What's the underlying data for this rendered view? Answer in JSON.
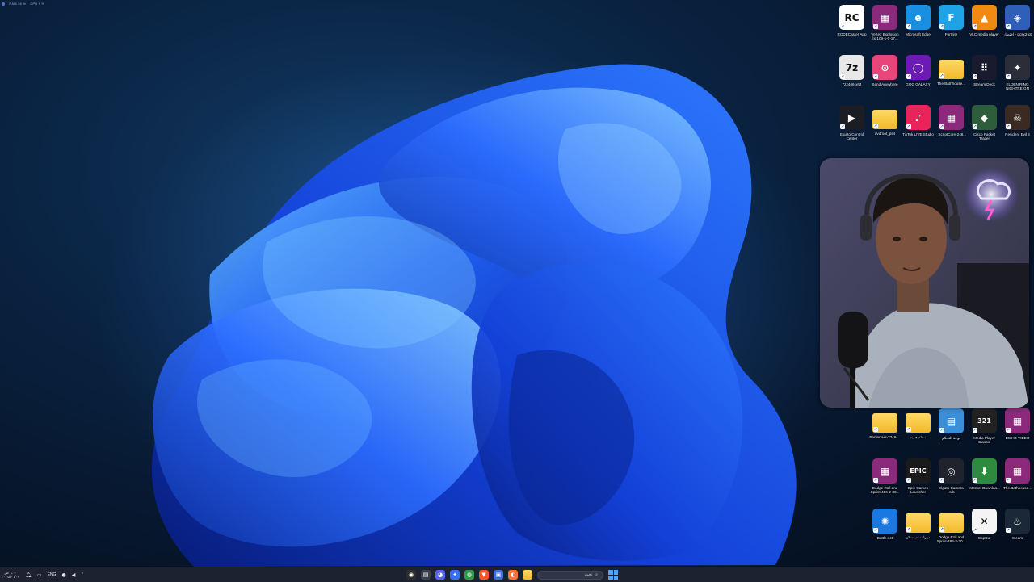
{
  "perf_overlay": [
    "RAM 28 %",
    "CPU 9 %"
  ],
  "desktop_icons": {
    "row1": [
      {
        "label": "RODECaster App",
        "icon": "rode-icon",
        "color": "#ffffff",
        "glyph": "RC"
      },
      {
        "label": "Vertex Explosion fix-109-1-0-17...",
        "icon": "winrar-icon",
        "color": "#8b2a7a",
        "glyph": "▦"
      },
      {
        "label": "Microsoft Edge",
        "icon": "edge-icon",
        "color": "#1a8fe0",
        "glyph": "e"
      },
      {
        "label": "Fortnite",
        "icon": "fortnite-icon",
        "color": "#1fa3e6",
        "glyph": "F"
      },
      {
        "label": "VLC media player",
        "icon": "vlc-icon",
        "color": "#f08a12",
        "glyph": "▲"
      },
      {
        "label": "اختصار - pcsx2-qt",
        "icon": "pcsx2-icon",
        "color": "#2f5fb7",
        "glyph": "◈"
      }
    ],
    "row2": [
      {
        "label": "7z2406-x64",
        "icon": "7zip-icon",
        "color": "#e8e8e8",
        "glyph": "7z"
      },
      {
        "label": "Send Anywhere",
        "icon": "send-anywhere-icon",
        "color": "#e8457a",
        "glyph": "⊙"
      },
      {
        "label": "GOG GALAXY",
        "icon": "gog-icon",
        "color": "#6b1bb3",
        "glyph": "◯"
      },
      {
        "label": "The.Bathhouse...",
        "icon": "folder-icon",
        "color": "#f2c23c",
        "glyph": ""
      },
      {
        "label": "Stream Deck",
        "icon": "stream-deck-icon",
        "color": "#1a1a2e",
        "glyph": "⠿"
      },
      {
        "label": "ELDEN RING NIGHTREIGN",
        "icon": "elden-ring-icon",
        "color": "#2b2d38",
        "glyph": "✦"
      }
    ],
    "row3": [
      {
        "label": "Elgato Control Center",
        "icon": "elgato-icon",
        "color": "#1c1c24",
        "glyph": "▶"
      },
      {
        "label": "dvdroot_ps4",
        "icon": "folder-icon",
        "color": "#f2c23c",
        "glyph": ""
      },
      {
        "label": "TikTok LIVE Studio",
        "icon": "tiktok-icon",
        "color": "#e8245a",
        "glyph": "♪"
      },
      {
        "label": "_ScriptCore-248...",
        "icon": "winrar-icon",
        "color": "#8b2a7a",
        "glyph": "▦"
      },
      {
        "label": "Cisco Packet Tracer",
        "icon": "cisco-icon",
        "color": "#2d5d3a",
        "glyph": "◆"
      },
      {
        "label": "Resident Evil 4",
        "icon": "resident-evil-icon",
        "color": "#3a2a22",
        "glyph": "☠"
      }
    ],
    "row4": [
      {
        "label": "Beniertaer-2346-...",
        "icon": "folder-icon",
        "color": "#f2c23c",
        "glyph": ""
      },
      {
        "label": "مجلد جديد",
        "icon": "folder-icon",
        "color": "#f2c23c",
        "glyph": ""
      },
      {
        "label": "لوحة التحكم",
        "icon": "control-panel-icon",
        "color": "#3b8fd9",
        "glyph": "▤"
      },
      {
        "label": "Media Player Classic",
        "icon": "mpc-icon",
        "color": "#222222",
        "glyph": "321"
      },
      {
        "label": "DS HD VIDEO",
        "icon": "winrar-icon",
        "color": "#8b2a7a",
        "glyph": "▦"
      }
    ],
    "row5": [
      {
        "label": "Dodge Roll and Sprint-496-2-30...",
        "icon": "winrar-icon",
        "color": "#8b2a7a",
        "glyph": "▦"
      },
      {
        "label": "Epic Games Launcher",
        "icon": "epic-games-icon",
        "color": "#1a1a1a",
        "glyph": "EPIC"
      },
      {
        "label": "Elgato Camera Hub",
        "icon": "camera-hub-icon",
        "color": "#20232c",
        "glyph": "◎"
      },
      {
        "label": "Internet Downloa...",
        "icon": "idm-icon",
        "color": "#2e8a3e",
        "glyph": "⬇"
      },
      {
        "label": "The.Bathhouse...",
        "icon": "winrar-icon",
        "color": "#8b2a7a",
        "glyph": "▦"
      }
    ],
    "row6": [
      {
        "label": "Battle.net",
        "icon": "battlenet-icon",
        "color": "#1a78e0",
        "glyph": "✺"
      },
      {
        "label": "دورات سيتسكو",
        "icon": "folder-icon",
        "color": "#f2c23c",
        "glyph": ""
      },
      {
        "label": "Dodge Roll and Sprint-496-2-30...",
        "icon": "folder-icon",
        "color": "#f2c23c",
        "glyph": ""
      },
      {
        "label": "CapCut",
        "icon": "capcut-icon",
        "color": "#f4f4f4",
        "glyph": "✕"
      },
      {
        "label": "Steam",
        "icon": "steam-icon",
        "color": "#1b2838",
        "glyph": "♨"
      }
    ]
  },
  "taskbar": {
    "clock_time": "٦:٠٠ ص",
    "clock_date": "٢٠٢٥/٠٦/٠٧",
    "language": "ENG",
    "search_placeholder": "بحث",
    "apps": [
      {
        "icon": "obs-icon",
        "color": "#2d2d2d",
        "glyph": "◉"
      },
      {
        "icon": "file-explorer-icon",
        "color": "#3a3f4b",
        "glyph": "▤"
      },
      {
        "icon": "discord-icon",
        "color": "#5865f2",
        "glyph": "◕"
      },
      {
        "icon": "copilot-icon",
        "color": "#3a6df0",
        "glyph": "✦"
      },
      {
        "icon": "chrome-icon",
        "color": "#2a9d4b",
        "glyph": "◍"
      },
      {
        "icon": "brave-icon",
        "color": "#fb542b",
        "glyph": "▼"
      },
      {
        "icon": "store-icon",
        "color": "#3b6fd8",
        "glyph": "▣"
      },
      {
        "icon": "firefox-icon",
        "color": "#ff7139",
        "glyph": "◐"
      },
      {
        "icon": "folder-icon",
        "color": "#f2c23c",
        "glyph": ""
      }
    ],
    "colors": {
      "accent": "#4ea5ff",
      "taskbar_bg": "#1c2230"
    }
  }
}
